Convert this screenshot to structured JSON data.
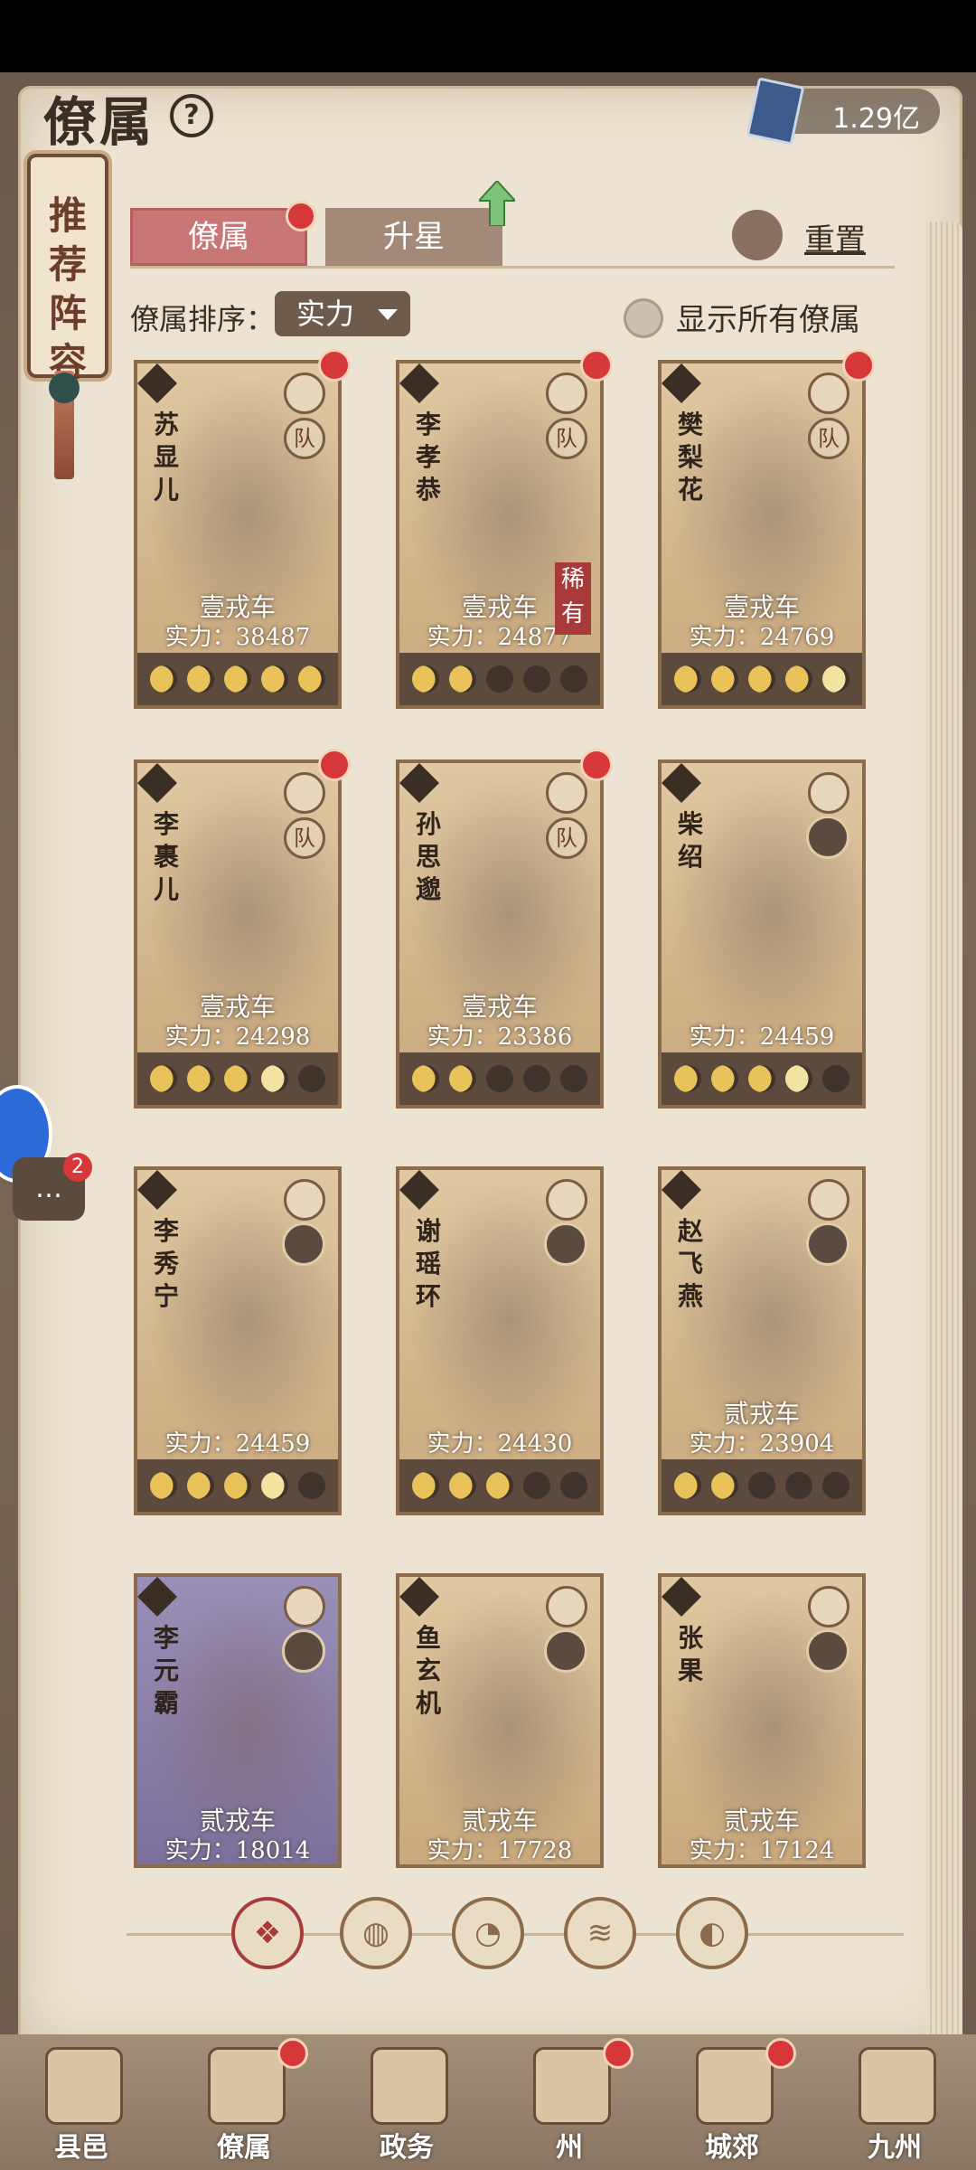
{
  "header": {
    "title": "僚属",
    "help_icon": "question-icon",
    "currency_value": "1.29亿"
  },
  "scroll_tag": {
    "label": "推荐阵容"
  },
  "tabs": [
    {
      "label": "僚属",
      "active": true,
      "has_dot": true
    },
    {
      "label": "升星",
      "active": false
    }
  ],
  "reset_label": "重置",
  "sort": {
    "label": "僚属排序：",
    "selected": "实力"
  },
  "show_all_label": "显示所有僚属",
  "cards": [
    {
      "name": "苏显儿",
      "rank": "壹戎车",
      "power": "实力：38487",
      "moons": 5,
      "half": 0,
      "team": "队",
      "dot": true,
      "rare": ""
    },
    {
      "name": "李孝恭",
      "rank": "壹戎车",
      "power": "实力：24877",
      "moons": 2,
      "half": 0,
      "team": "队",
      "dot": true,
      "rare": "稀有"
    },
    {
      "name": "樊梨花",
      "rank": "壹戎车",
      "power": "实力：24769",
      "moons": 4,
      "half": 1,
      "team": "队",
      "dot": true,
      "rare": ""
    },
    {
      "name": "李裹儿",
      "rank": "壹戎车",
      "power": "实力：24298",
      "moons": 3,
      "half": 1,
      "team": "队",
      "dot": true,
      "rare": ""
    },
    {
      "name": "孙思邈",
      "rank": "壹戎车",
      "power": "实力：23386",
      "moons": 2,
      "half": 0,
      "team": "队",
      "dot": true,
      "rare": ""
    },
    {
      "name": "柴绍",
      "rank": "",
      "power": "实力：24459",
      "moons": 3,
      "half": 1,
      "team": "",
      "dot": false,
      "rare": ""
    },
    {
      "name": "李秀宁",
      "rank": "",
      "power": "实力：24459",
      "moons": 3,
      "half": 1,
      "team": "",
      "dot": false,
      "rare": ""
    },
    {
      "name": "谢瑶环",
      "rank": "",
      "power": "实力：24430",
      "moons": 3,
      "half": 0,
      "team": "",
      "dot": false,
      "rare": ""
    },
    {
      "name": "赵飞燕",
      "rank": "贰戎车",
      "power": "实力：23904",
      "moons": 2,
      "half": 0,
      "team": "",
      "dot": false,
      "rare": ""
    },
    {
      "name": "李元霸",
      "rank": "贰戎车",
      "power": "实力：18014",
      "moons": 0,
      "half": 0,
      "team": "",
      "dot": false,
      "rare": ""
    },
    {
      "name": "鱼玄机",
      "rank": "贰戎车",
      "power": "实力：17728",
      "moons": 0,
      "half": 0,
      "team": "",
      "dot": false,
      "rare": ""
    },
    {
      "name": "张果",
      "rank": "贰戎车",
      "power": "实力：17124",
      "moons": 0,
      "half": 0,
      "team": "",
      "dot": false,
      "rare": ""
    }
  ],
  "filters": [
    "❖",
    "◍",
    "◔",
    "≋",
    "◐"
  ],
  "side": {
    "chat_count": "2"
  },
  "nav": [
    {
      "label": "县邑",
      "dot": false
    },
    {
      "label": "僚属",
      "dot": true
    },
    {
      "label": "政务",
      "dot": false
    },
    {
      "label": "州",
      "dot": true
    },
    {
      "label": "城郊",
      "dot": true
    },
    {
      "label": "九州",
      "dot": false
    }
  ]
}
